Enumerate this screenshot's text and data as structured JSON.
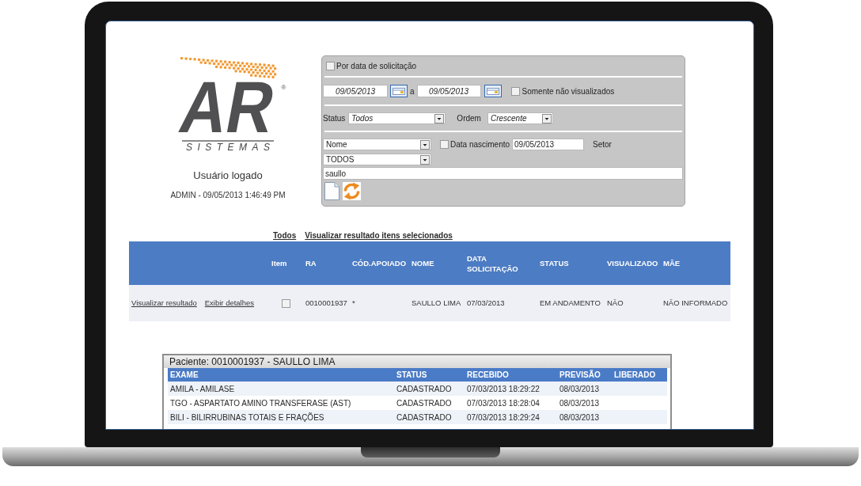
{
  "logo": {
    "mark": "AR",
    "registered": "®",
    "tagline": "SISTEMAS"
  },
  "user": {
    "heading": "Usuário logado",
    "session": "ADMIN - 09/05/2013 1:46:49 PM"
  },
  "filters": {
    "by_request_date": {
      "label": "Por data de solicitação",
      "checked": false
    },
    "date_from": "09/05/2013",
    "date_separator": "a",
    "date_to": "09/05/2013",
    "only_unviewed": {
      "label": "Somente não visualizados",
      "checked": false
    },
    "status": {
      "label": "Status",
      "value": "Todos"
    },
    "order": {
      "label": "Ordem",
      "value": "Crescente"
    },
    "search_field": {
      "value": "Nome"
    },
    "birth_date": {
      "label": "Data nascimento",
      "checked": false,
      "value": "09/05/2013"
    },
    "sector": {
      "label": "Setor",
      "value": "TODOS"
    },
    "search_text": "saullo"
  },
  "links": [
    {
      "label": "Todos"
    },
    {
      "label": "Visualizar resultado itens selecionados"
    }
  ],
  "results": {
    "item_header": "Item",
    "columns": [
      "RA",
      "CÓD.APOIADO",
      "NOME",
      "DATA SOLICITAÇÃO",
      "STATUS",
      "VISUALIZADO",
      "MÃE"
    ],
    "rows": [
      {
        "links": [
          "Visualizar resultado",
          "Exibir detalhes"
        ],
        "checked": false,
        "cells": [
          "0010001937",
          "*",
          "SAULLO LIMA",
          "07/03/2013",
          "EM ANDAMENTO",
          "NÃO",
          "NÃO INFORMADO"
        ]
      }
    ]
  },
  "patient_panel": {
    "title": "Paciente: 0010001937 - SAULLO LIMA",
    "columns": [
      "EXAME",
      "STATUS",
      "RECEBIDO",
      "PREVISÃO",
      "LIBERADO"
    ],
    "rows": [
      {
        "cells": [
          "AMILA - AMILASE",
          "CADASTRADO",
          "07/03/2013 18:29:22",
          "08/03/2013"
        ]
      },
      {
        "cells": [
          "TGO - ASPARTATO AMINO TRANSFERASE (AST)",
          "CADASTRADO",
          "07/03/2013 18:28:04",
          "08/03/2013"
        ]
      },
      {
        "cells": [
          "BILI - BILIRRUBINAS TOTAIS E FRAÇÕES",
          "CADASTRADO",
          "07/03/2013 18:29:24",
          "08/03/2013"
        ]
      }
    ]
  }
}
